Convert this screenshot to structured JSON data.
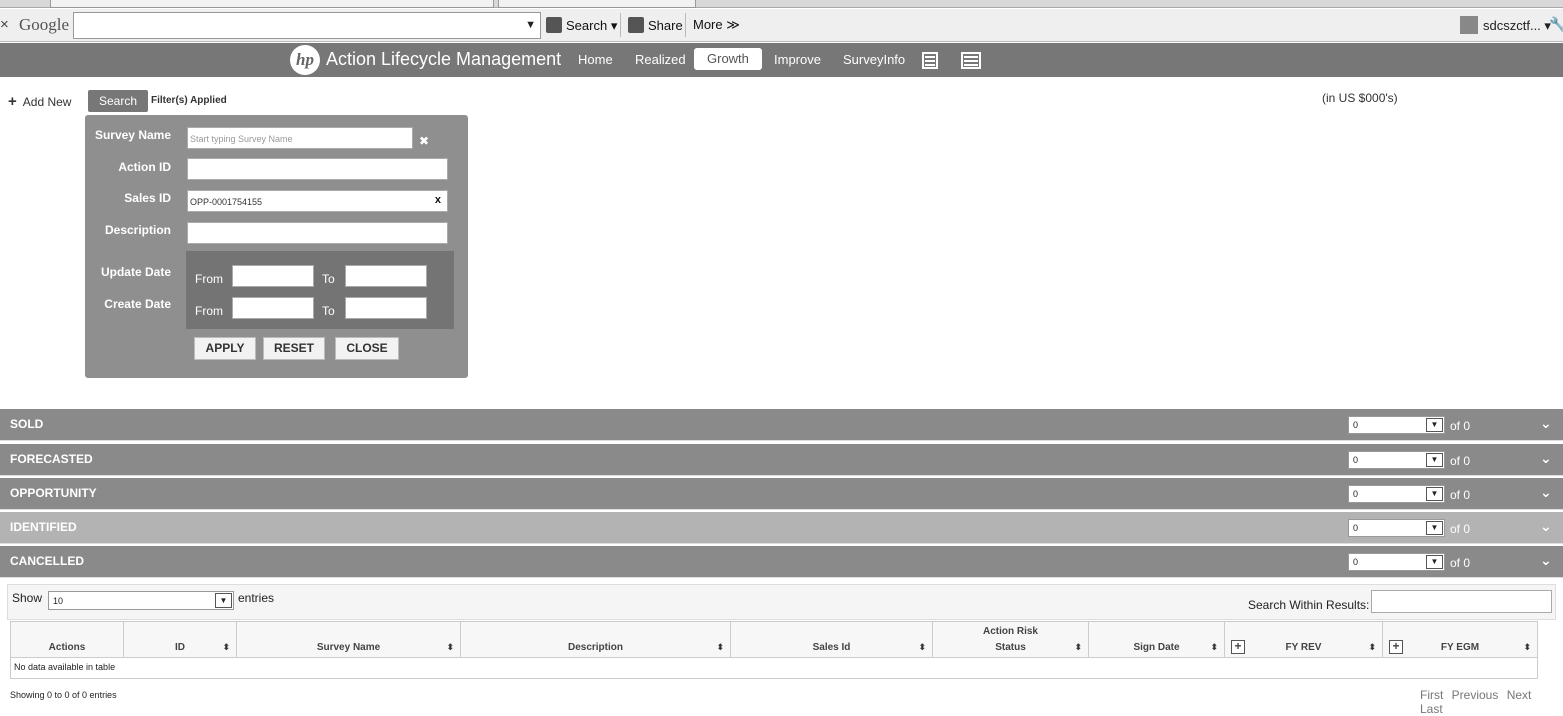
{
  "browser": {
    "close_glyph": "×",
    "google_logo": "Google",
    "search_label": "Search",
    "share_label": "Share",
    "more_label": "More ≫",
    "user": "sdcszctf..."
  },
  "app": {
    "logo_text": "hp",
    "title": "Action Lifecycle Management",
    "nav": [
      "Home",
      "Realized",
      "Growth",
      "Improve",
      "SurveyInfo"
    ],
    "active_nav": "Growth"
  },
  "controls": {
    "add_new": "Add New",
    "search_button": "Search",
    "filters_applied": "Filter(s) Applied",
    "units": "(in US $000's)"
  },
  "search_form": {
    "survey_name_label": "Survey Name",
    "survey_name_placeholder": "Start typing Survey Name",
    "action_id_label": "Action ID",
    "sales_id_label": "Sales ID",
    "sales_id_value": "OPP-0001754155",
    "description_label": "Description",
    "update_date_label": "Update Date",
    "create_date_label": "Create Date",
    "from_label": "From",
    "to_label": "To",
    "apply": "APPLY",
    "reset": "RESET",
    "close": "CLOSE",
    "clear_glyph": "✖",
    "clear_x": "x"
  },
  "sections": [
    {
      "name": "SOLD",
      "page": "0",
      "of": "of 0"
    },
    {
      "name": "FORECASTED",
      "page": "0",
      "of": "of 0"
    },
    {
      "name": "OPPORTUNITY",
      "page": "0",
      "of": "of 0"
    },
    {
      "name": "IDENTIFIED",
      "page": "0",
      "of": "of 0"
    },
    {
      "name": "CANCELLED",
      "page": "0",
      "of": "of 0"
    }
  ],
  "table": {
    "show_label": "Show",
    "page_size": "10",
    "entries_label": "entries",
    "search_within": "Search Within Results:",
    "columns": [
      "Actions",
      "ID",
      "Survey Name",
      "Description",
      "Sales Id",
      "Action Risk",
      "Status",
      "Sign Date",
      "FY REV",
      "FY EGM"
    ],
    "empty_message": "No data available in table",
    "info": "Showing 0 to 0 of 0 entries",
    "pager": [
      "First",
      "Previous",
      "Next",
      "Last"
    ]
  }
}
